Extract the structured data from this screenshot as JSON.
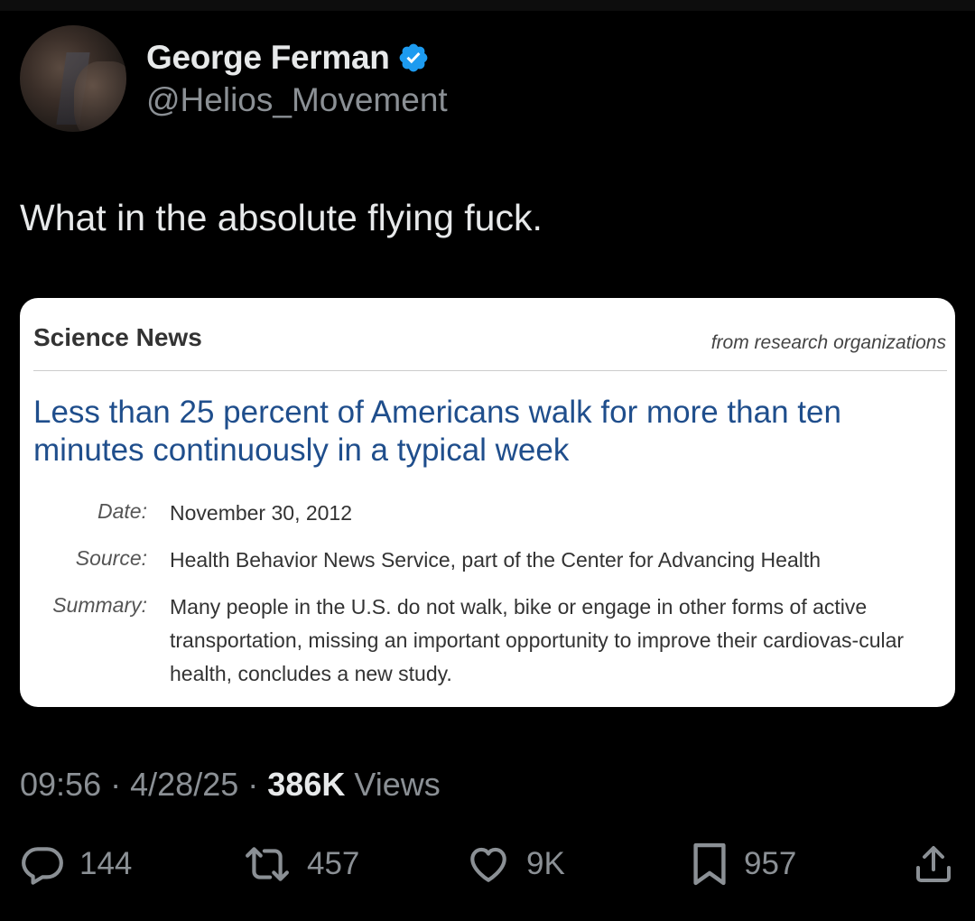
{
  "author": {
    "display_name": "George Ferman",
    "handle": "@Helios_Movement",
    "verified": true,
    "verified_color": "#1d9bf0"
  },
  "tweet": {
    "text": "What in the absolute flying fuck."
  },
  "card": {
    "brand": "Science News",
    "tagline": "from research organizations",
    "headline": "Less than 25 percent of Americans walk for more than ten minutes continuously in a typical week",
    "date_label": "Date:",
    "date_value": "November 30, 2012",
    "source_label": "Source:",
    "source_value": "Health Behavior News Service, part of the Center for Advancing Health",
    "summary_label": "Summary:",
    "summary_value": "Many people in the U.S. do not walk, bike or engage in other forms of active transportation, missing an important opportunity to improve their cardiovas-cular health, concludes a new study.",
    "headline_color": "#1f4e8c"
  },
  "meta": {
    "time": "09:56",
    "separator": "·",
    "date": "4/28/25",
    "views_count": "386K",
    "views_label": "Views"
  },
  "actions": {
    "replies": "144",
    "reposts": "457",
    "likes": "9K",
    "bookmarks": "957"
  },
  "icons": {
    "reply": "reply-icon",
    "repost": "repost-icon",
    "like": "heart-icon",
    "bookmark": "bookmark-icon",
    "share": "share-icon",
    "verified": "verified-badge-icon"
  }
}
